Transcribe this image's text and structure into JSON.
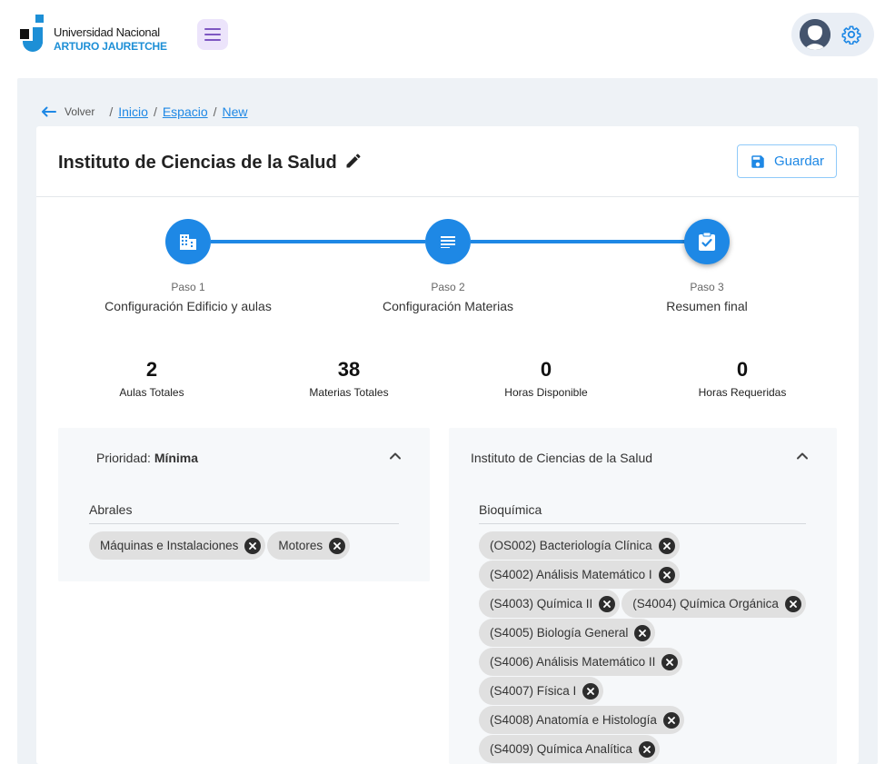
{
  "brand": {
    "line1": "Universidad Nacional",
    "line2": "ARTURO JAURETCHE",
    "accent": "#1d8fd6"
  },
  "header": {
    "menu_icon": "hamburger-icon",
    "avatar_icon": "user-avatar",
    "settings_icon": "gear-icon"
  },
  "breadcrumb": {
    "back_label": "Volver",
    "items": [
      "Inicio",
      "Espacio",
      "New"
    ],
    "separator": "/"
  },
  "page": {
    "title": "Instituto de Ciencias de la Salud",
    "save_label": "Guardar"
  },
  "stepper": {
    "steps": [
      {
        "small": "Paso 1",
        "label": "Configuración Edificio y aulas",
        "icon": "building-icon"
      },
      {
        "small": "Paso 2",
        "label": "Configuración Materias",
        "icon": "list-icon"
      },
      {
        "small": "Paso 3",
        "label": "Resumen final",
        "icon": "clipboard-check-icon"
      }
    ],
    "color": "#1e88e5"
  },
  "stats": [
    {
      "value": "2",
      "label": "Aulas Totales"
    },
    {
      "value": "38",
      "label": "Materias Totales"
    },
    {
      "value": "0",
      "label": "Horas Disponible"
    },
    {
      "value": "0",
      "label": "Horas Requeridas"
    }
  ],
  "left_panel": {
    "priority_prefix": "Prioridad:",
    "priority_value": "Mínima",
    "group_title": "Abrales",
    "chips": [
      "Máquinas e Instalaciones",
      "Motores"
    ]
  },
  "right_panel": {
    "title": "Instituto de Ciencias de la Salud",
    "group_title": "Bioquímica",
    "chips": [
      "(OS002) Bacteriología Clínica",
      "(S4002) Análisis Matemático I",
      "(S4003) Química II",
      "(S4004) Química Orgánica",
      "(S4005) Biología General",
      "(S4006) Análisis Matemático II",
      "(S4007) Física I",
      "(S4008) Anatomía e Histología",
      "(S4009) Química Analítica"
    ]
  }
}
